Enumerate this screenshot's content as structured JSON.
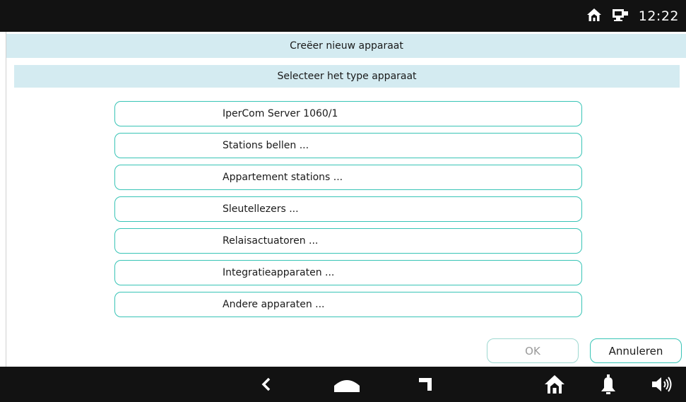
{
  "status_bar": {
    "time": "12:22",
    "icons": [
      "home-icon",
      "network-monitor-icon"
    ]
  },
  "dialog": {
    "title": "Creëer nieuw apparaat",
    "subtitle": "Selecteer het type apparaat",
    "device_types": [
      "IperCom Server 1060/1",
      "Stations bellen ...",
      "Appartement stations ...",
      "Sleutellezers ...",
      "Relaisactuatoren ...",
      "Integratieapparaten ...",
      "Andere apparaten ..."
    ],
    "ok_label": "OK",
    "cancel_label": "Annuleren"
  },
  "nav_bar": {
    "icons": [
      "back-icon",
      "home-icon",
      "recent-apps-icon",
      "house-icon",
      "bell-icon",
      "speaker-icon"
    ]
  },
  "colors": {
    "accent": "#38c4b6",
    "header_bg": "#d4ebf1",
    "bar_bg": "#121212"
  }
}
